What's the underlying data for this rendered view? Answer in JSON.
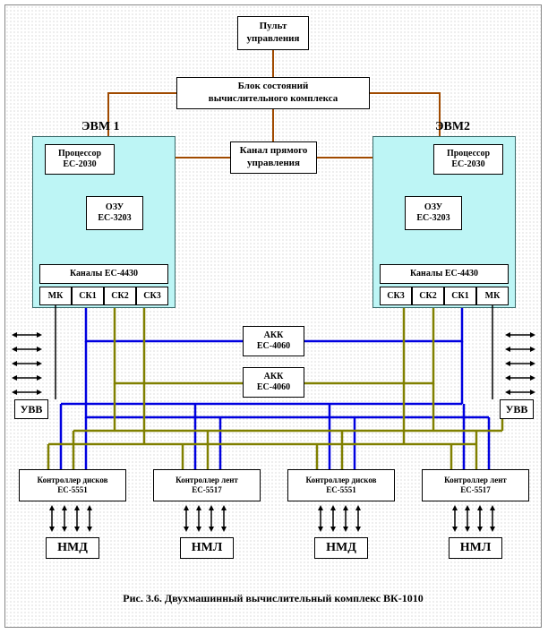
{
  "console": {
    "line1": "Пульт",
    "line2": "управления"
  },
  "status_block": {
    "line1": "Блок состояний",
    "line2": "вычислительного комплекса"
  },
  "direct_channel": {
    "line1": "Канал прямого",
    "line2": "управления"
  },
  "evm1": {
    "title": "ЭВМ 1",
    "processor": {
      "line1": "Процессор",
      "line2": "ЕС-2030"
    },
    "ram": {
      "line1": "ОЗУ",
      "line2": "ЕС-3203"
    },
    "channels_label": "Каналы ЕС-4430",
    "ch": [
      "МК",
      "СК1",
      "СК2",
      "СК3"
    ]
  },
  "evm2": {
    "title": "ЭВМ2",
    "processor": {
      "line1": "Процессор",
      "line2": "ЕС-2030"
    },
    "ram": {
      "line1": "ОЗУ",
      "line2": "ЕС-3203"
    },
    "channels_label": "Каналы ЕС-4430",
    "ch": [
      "СК3",
      "СК2",
      "СК1",
      "МК"
    ]
  },
  "akk1": {
    "line1": "АКК",
    "line2": "ЕС-4060"
  },
  "akk2": {
    "line1": "АКК",
    "line2": "ЕС-4060"
  },
  "uvv_left": "УВВ",
  "uvv_right": "УВВ",
  "controllers": {
    "c1": {
      "line1": "Контроллер дисков",
      "line2": "ЕС-5551"
    },
    "c2": {
      "line1": "Контроллер лент",
      "line2": "ЕС-5517"
    },
    "c3": {
      "line1": "Контроллер дисков",
      "line2": "ЕС-5551"
    },
    "c4": {
      "line1": "Контроллер лент",
      "line2": "ЕС-5517"
    }
  },
  "nmd": "НМД",
  "nml": "НМЛ",
  "caption": "Рис. 3.6. Двухмашинный вычислительный комплекс ВК-1010"
}
